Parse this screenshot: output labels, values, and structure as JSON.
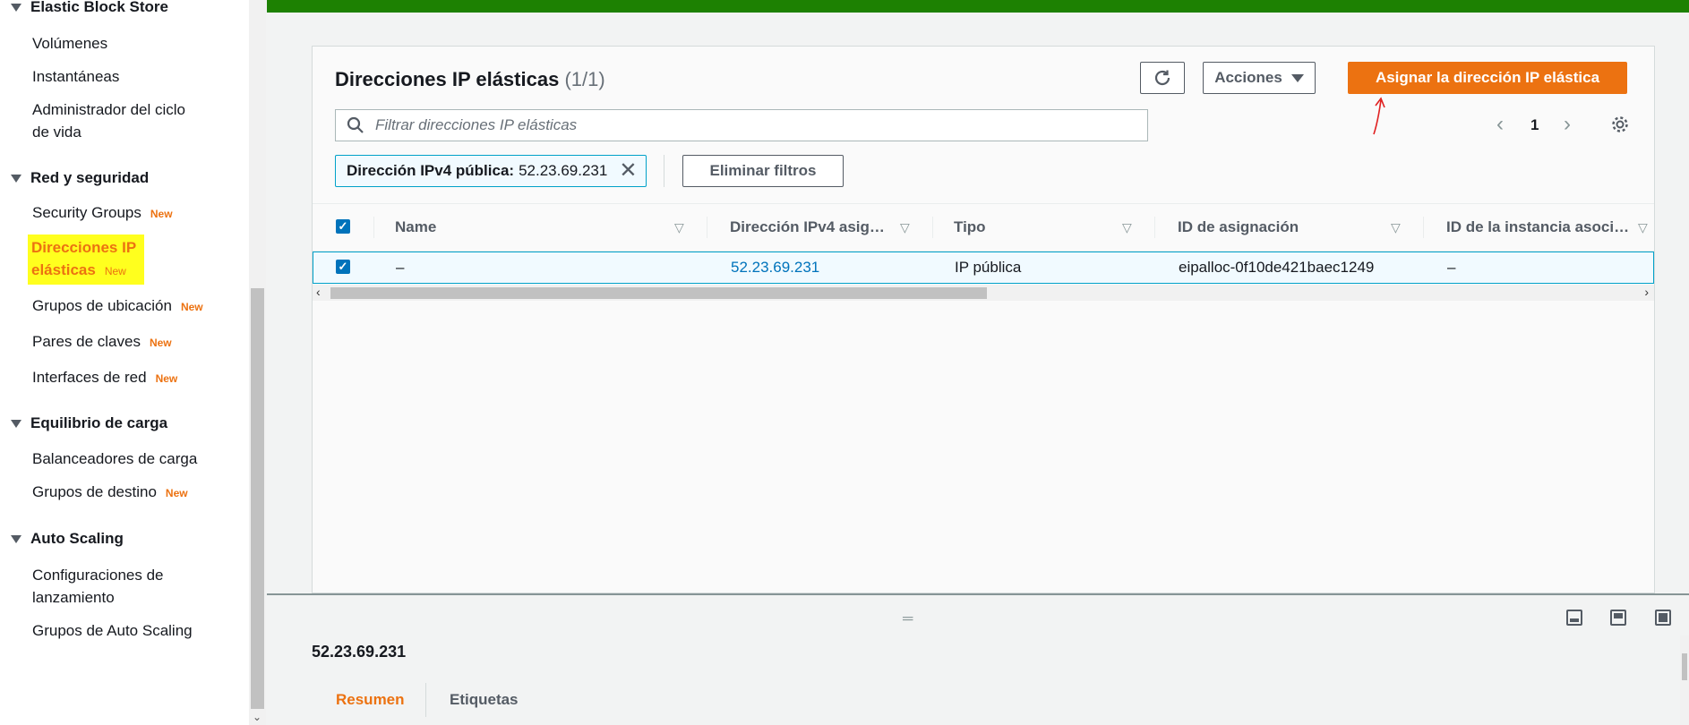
{
  "colors": {
    "accent": "#ec7211",
    "top_banner": "#1d8102",
    "link": "#0073bb",
    "highlight": "#ffff1e",
    "annotation": "#e02020"
  },
  "sidebar": {
    "sections": [
      {
        "title": "Elastic Block Store",
        "items": [
          "Volúmenes",
          "Instantáneas",
          "Administrador del ciclo de vida"
        ]
      },
      {
        "title": "Red y seguridad",
        "items": [
          "Security Groups",
          "Direcciones IP elásticas",
          "Grupos de ubicación",
          "Pares de claves",
          "Interfaces de red"
        ]
      },
      {
        "title": "Equilibrio de carga",
        "items": [
          "Balanceadores de carga",
          "Grupos de destino"
        ]
      },
      {
        "title": "Auto Scaling",
        "items": [
          "Configuraciones de lanzamiento",
          "Grupos de Auto Scaling"
        ]
      }
    ],
    "new_badge": "New"
  },
  "panel": {
    "title": "Direcciones IP elásticas",
    "count": "(1/1)",
    "refresh_icon": "refresh-icon",
    "actions_label": "Acciones",
    "allocate_label": "Asignar la dirección IP elástica",
    "search_placeholder": "Filtrar direcciones IP elásticas",
    "page": "1",
    "filter_key": "Dirección IPv4 pública:",
    "filter_value": "52.23.69.231",
    "clear_filters_label": "Eliminar filtros"
  },
  "table": {
    "columns": [
      "Name",
      "Dirección IPv4 asig…",
      "Tipo",
      "ID de asignación",
      "ID de la instancia asoci…"
    ],
    "rows": [
      {
        "name": "–",
        "ip": "52.23.69.231",
        "type": "IP pública",
        "allocation_id": "eipalloc-0f10de421baec1249",
        "instance_id": "–"
      }
    ]
  },
  "details": {
    "ip": "52.23.69.231",
    "tabs": [
      "Resumen",
      "Etiquetas"
    ]
  }
}
